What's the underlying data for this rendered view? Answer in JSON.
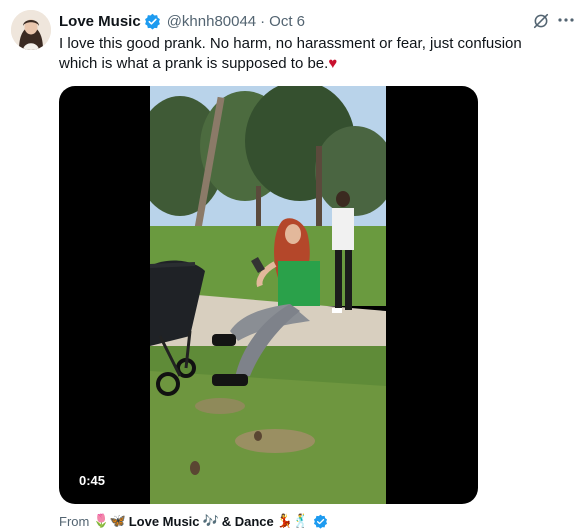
{
  "author": {
    "name": "Love Music",
    "handle": "@khnh80044",
    "separator": "·",
    "date": "Oct 6"
  },
  "tweet": {
    "text": "I love this good prank. No harm, no harassment or fear, just confusion which is what a prank is supposed to be.",
    "emoji": "♥"
  },
  "media": {
    "duration": "0:45"
  },
  "source": {
    "label": "From",
    "emoji_before": "🌷🦋",
    "name_part1": "Love Music",
    "emoji_mid": "🎶",
    "name_part2": "& Dance",
    "emoji_after": "💃🕺"
  },
  "colors": {
    "verified": "#1d9bf0",
    "secondary_text": "#536471",
    "heart": "#c8102e"
  },
  "icons": {
    "verified": "verified-badge-icon",
    "grok": "grok-icon",
    "more": "more-icon"
  }
}
